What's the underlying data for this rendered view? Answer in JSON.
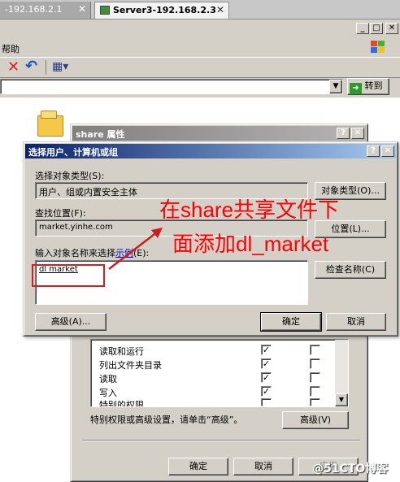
{
  "tabs": [
    {
      "label": "-192.168.2.1",
      "active": false
    },
    {
      "label": "Server3-192.168.2.3",
      "active": true
    }
  ],
  "menu": {
    "help": "帮助"
  },
  "address_bar": {
    "go_label": "转到"
  },
  "props_window": {
    "title": "share 属性",
    "perm_rows": [
      {
        "label": "读取和运行",
        "allow": true
      },
      {
        "label": "列出文件夹目录",
        "allow": true
      },
      {
        "label": "读取",
        "allow": true
      },
      {
        "label": "写入",
        "allow": true
      },
      {
        "label": "特别的权限",
        "allow": false
      }
    ],
    "special_text": "特别权限或高级设置，请单击“高级”。",
    "advanced_button": "高级(V)",
    "ok": "确定",
    "cancel": "取消",
    "apply": "应用"
  },
  "select_dialog": {
    "title": "选择用户、计算机或组",
    "object_type_label": "选择对象类型(S):",
    "object_type_value": "用户、组或内置安全主体",
    "object_type_button": "对象类型(O)...",
    "location_label": "查找位置(F):",
    "location_value": "market.yinhe.com",
    "location_button": "位置(L)...",
    "enter_names_label": "输入对象名称来选择",
    "example_link": "示例",
    "enter_names_suffix": "(E):",
    "names_value": "dl market",
    "check_names_button": "检查名称(C)",
    "advanced_button": "高级(A)...",
    "ok": "确定",
    "cancel": "取消"
  },
  "annotation": {
    "line1": "在share共享文件下",
    "line2": "面添加dl_market",
    "color": "#ff0000"
  },
  "watermark": "@51CTO博客"
}
